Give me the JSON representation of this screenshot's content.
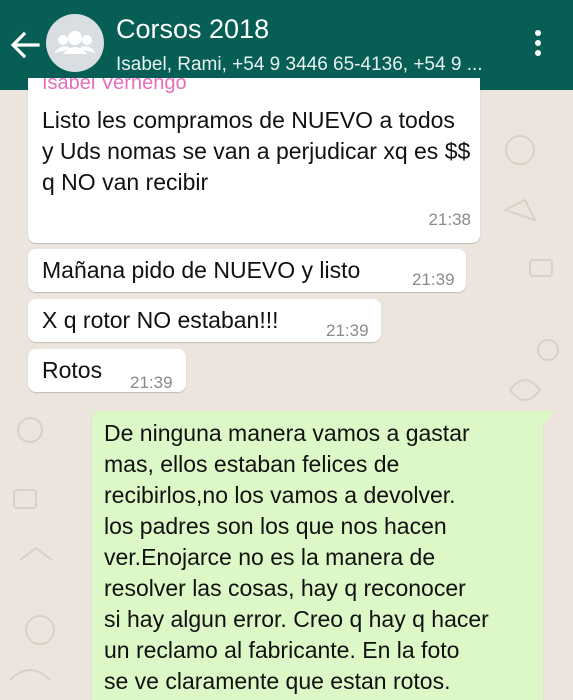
{
  "header": {
    "title": "Corsos 2018",
    "participants": "Isabel, Rami, +54 9 3446 65-4136, +54 9 ..."
  },
  "messages": [
    {
      "direction": "incoming",
      "sender": "Isabel Vernengo",
      "text": "Listo les compramos de NUEVO a todos y Uds nomas se van a perjudicar xq es $$ q NO van recibir",
      "time": "21:38"
    },
    {
      "direction": "incoming",
      "text": "Mañana pido de NUEVO y listo",
      "time": "21:39"
    },
    {
      "direction": "incoming",
      "text": "X q rotor NO  estaban!!!",
      "time": "21:39"
    },
    {
      "direction": "incoming",
      "text": "Rotos",
      "time": "21:39"
    },
    {
      "direction": "outgoing",
      "text": "De ninguna manera vamos a gastar\nmas, ellos estaban felices  de\nrecibirlos,no los vamos a devolver.\nlos padres son los que nos hacen\nver.Enojarce no es la manera de\nresolver las cosas, hay q reconocer\nsi hay algun error. Creo q hay q hacer\nun reclamo al fabricante. En la foto\nse ve claramente que estan rotos."
    }
  ],
  "colors": {
    "header": "#075e54",
    "chat_background": "#ece5dd",
    "incoming_bubble": "#ffffff",
    "outgoing_bubble": "#dcf8c6",
    "sender_name": "#e56fbd"
  },
  "icons": {
    "back": "arrow-left",
    "avatar": "group-avatar",
    "menu": "more-vertical"
  }
}
